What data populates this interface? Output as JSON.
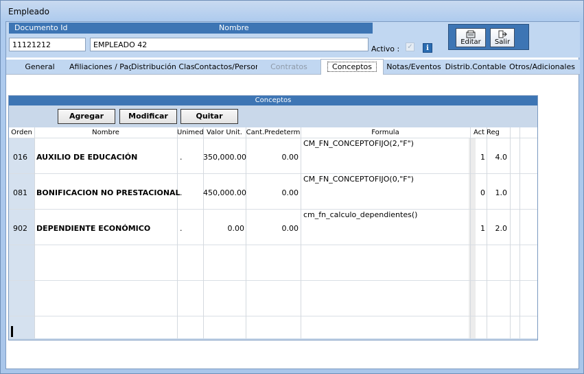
{
  "window": {
    "title": "Empleado"
  },
  "header": {
    "documento_label": "Documento Id",
    "nombre_label": "Nombre",
    "documento_value": "11121212",
    "nombre_value": "EMPLEADO 42",
    "activo_label": "Activo :",
    "activo_checked": true,
    "info_icon": "i",
    "editar_label": "Editar",
    "salir_label": "Salir"
  },
  "tabs": [
    {
      "label": "General",
      "state": "normal"
    },
    {
      "label": "Afiliaciones / Pag",
      "state": "normal"
    },
    {
      "label": "Distribución Clase",
      "state": "normal"
    },
    {
      "label": "Contactos/Person",
      "state": "normal"
    },
    {
      "label": "Contratos",
      "state": "disabled"
    },
    {
      "label": "Conceptos",
      "state": "active"
    },
    {
      "label": "Notas/Eventos",
      "state": "normal"
    },
    {
      "label": "Distrib.Contable",
      "state": "normal"
    },
    {
      "label": "Otros/Adicionales",
      "state": "normal"
    }
  ],
  "conceptos": {
    "title": "Conceptos",
    "buttons": {
      "agregar": "Agregar",
      "modificar": "Modificar",
      "quitar": "Quitar"
    },
    "columns": [
      "Orden",
      "Nombre",
      "Unimed",
      "Valor Unit.",
      "Cant.Predeterm",
      "Formula",
      "Act",
      "Reg"
    ],
    "rows": [
      {
        "orden": "016",
        "nombre": "AUXILIO DE EDUCACIÓN",
        "unimed": ".",
        "valor": "350,000.00",
        "cant": "0.00",
        "formula": "CM_FN_CONCEPTOFIJO(2,\"F\")",
        "act": "1",
        "reg": "4.0"
      },
      {
        "orden": "081",
        "nombre": "BONIFICACION NO PRESTACIONAL",
        "unimed": ".",
        "valor": "450,000.00",
        "cant": "0.00",
        "formula": "CM_FN_CONCEPTOFIJO(0,\"F\")",
        "act": "0",
        "reg": "1.0"
      },
      {
        "orden": "902",
        "nombre": "DEPENDIENTE ECONÓMICO",
        "unimed": ".",
        "valor": "0.00",
        "cant": "0.00",
        "formula": "cm_fn_calculo_dependientes()",
        "act": "1",
        "reg": "2.0"
      }
    ]
  },
  "icons": {
    "editar": "edit-icon",
    "salir": "exit-icon",
    "info": "info-icon",
    "checkbox": "check-icon"
  },
  "colors": {
    "header_blue": "#3d75b4",
    "panel_bg": "#c9d8ea",
    "window_bg": "#aecbee"
  }
}
